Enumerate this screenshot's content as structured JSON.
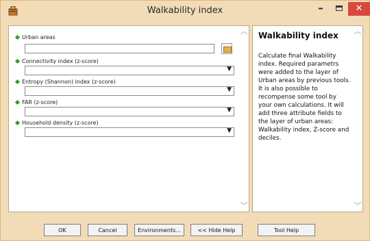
{
  "window": {
    "title": "Walkability index",
    "minimize_label": "–",
    "close_label": "✕",
    "icons": {
      "app": "toolbox-icon",
      "browse": "folder-icon"
    },
    "colors": {
      "frame": "#f2dcb8",
      "close": "#d9473d",
      "bullet": "#2e9a2e"
    }
  },
  "params": [
    {
      "label": "Urban areas",
      "value": "",
      "kind": "dataset"
    },
    {
      "label": "Connectivity index (z-score)",
      "value": "",
      "kind": "field"
    },
    {
      "label": "Entropy (Shannon) index (z-score)",
      "value": "",
      "kind": "field"
    },
    {
      "label": "FAR (z-score)",
      "value": "",
      "kind": "field"
    },
    {
      "label": "Household density (z-score)",
      "value": "",
      "kind": "field"
    }
  ],
  "help": {
    "title": "Walkability index",
    "body": "Calculate final Walkability index. Required parametrs were added to the layer of Urban areas by previous tools. It is also possible to recompense some tool by your own calculations. It will add three attribute fields to the layer of urban areas: Walkability index, Z-score and deciles."
  },
  "buttons": {
    "ok": "OK",
    "cancel": "Cancel",
    "environments": "Environments...",
    "hide_help": "<< Hide Help",
    "tool_help": "Tool Help"
  }
}
